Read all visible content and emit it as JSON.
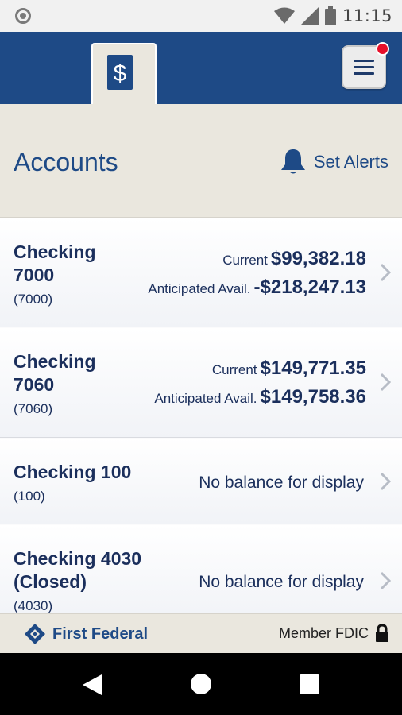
{
  "status_bar": {
    "time": "11:15"
  },
  "header": {
    "active_tab_icon": "dollar-cards-icon",
    "menu_icon": "hamburger-menu-icon"
  },
  "page": {
    "title": "Accounts",
    "set_alerts_label": "Set Alerts"
  },
  "accounts": [
    {
      "name_line1": "Checking",
      "name_line2": "7000",
      "number": "(7000)",
      "current_label": "Current",
      "current_value": "$99,382.18",
      "avail_label": "Anticipated Avail.",
      "avail_value": "-$218,247.13"
    },
    {
      "name_line1": "Checking",
      "name_line2": "7060",
      "number": "(7060)",
      "current_label": "Current",
      "current_value": "$149,771.35",
      "avail_label": "Anticipated Avail.",
      "avail_value": "$149,758.36"
    },
    {
      "name_line1": "Checking 100",
      "number": "(100)",
      "no_balance": "No balance for display"
    },
    {
      "name_line1": "Checking 4030",
      "name_line2": "(Closed)",
      "number": "(4030)",
      "no_balance": "No balance for display"
    }
  ],
  "footer": {
    "brand": "First Federal",
    "fdic": "Member FDIC"
  },
  "colors": {
    "brand_blue": "#1e4a86",
    "text_navy": "#1b2f5c",
    "band_beige": "#eae7de",
    "notify_red": "#e8102a"
  }
}
